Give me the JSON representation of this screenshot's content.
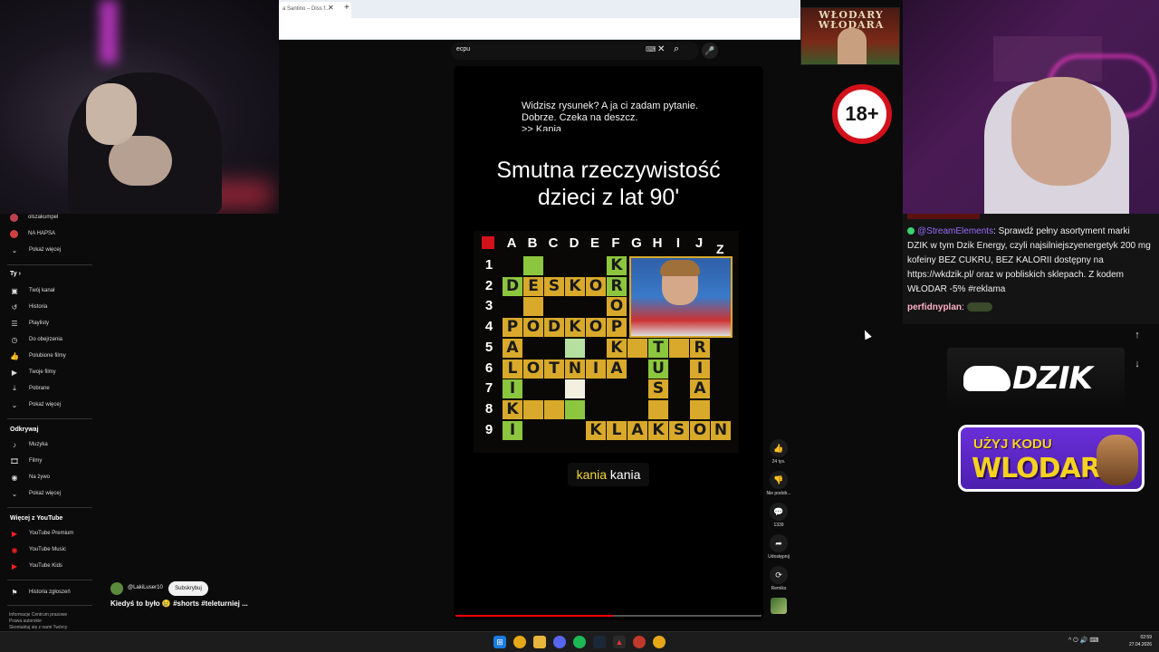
{
  "browser": {
    "tab_title": "a Santino – Diss f...",
    "new_tab": "+"
  },
  "search": {
    "query": "ecpu"
  },
  "banner": {
    "title": "WŁODARY WŁODARA"
  },
  "age_badge": "18+",
  "sidebar": {
    "subs": [
      {
        "label": "olszakumpel",
        "color": "#c04050"
      },
      {
        "label": "NA HAPSA",
        "color": "#d04040"
      },
      {
        "label": "Pokaż więcej",
        "icon": "chevron-down-icon"
      }
    ],
    "you_header": "Ty",
    "you_items": [
      {
        "label": "Twój kanał",
        "icon": "channel-icon"
      },
      {
        "label": "Historia",
        "icon": "history-icon"
      },
      {
        "label": "Playlisty",
        "icon": "playlist-icon"
      },
      {
        "label": "Do obejrzenia",
        "icon": "clock-icon"
      },
      {
        "label": "Polubione filmy",
        "icon": "like-icon"
      },
      {
        "label": "Twoje filmy",
        "icon": "video-icon"
      },
      {
        "label": "Pobrane",
        "icon": "download-icon"
      },
      {
        "label": "Pokaż więcej",
        "icon": "chevron-down-icon"
      }
    ],
    "explore_header": "Odkrywaj",
    "explore_items": [
      {
        "label": "Muzyka",
        "icon": "music-icon"
      },
      {
        "label": "Filmy",
        "icon": "film-icon"
      },
      {
        "label": "Na żywo",
        "icon": "live-icon"
      },
      {
        "label": "Pokaż więcej",
        "icon": "chevron-down-icon"
      }
    ],
    "more_header": "Więcej z YouTube",
    "more_items": [
      {
        "label": "YouTube Premium",
        "icon": "youtube-premium-icon"
      },
      {
        "label": "YouTube Music",
        "icon": "youtube-music-icon"
      },
      {
        "label": "YouTube Kids",
        "icon": "youtube-kids-icon"
      }
    ],
    "report_item": {
      "label": "Historia zgłoszeń",
      "icon": "flag-icon"
    },
    "footer": [
      "Informacje  Centrum prasowe",
      "Prawa autorskie",
      "Skontaktuj się z nami  Twórcy"
    ]
  },
  "short": {
    "dialog_lines": [
      "Widzisz rysunek? A ja ci zadam pytanie.",
      "Dobrze. Czeka na deszcz.",
      ">> Kania"
    ],
    "title_lines": [
      "Smutna rzeczywistość",
      "dzieci z lat 90'"
    ],
    "caption_highlight": "kania",
    "caption_rest": " kania",
    "progress": 0.515,
    "crossword": {
      "columns": [
        "A",
        "B",
        "C",
        "D",
        "E",
        "F",
        "G",
        "H",
        "I",
        "J"
      ],
      "rows": [
        "1",
        "2",
        "3",
        "4",
        "5",
        "6",
        "7",
        "8",
        "9"
      ],
      "col_extra": "Z"
    }
  },
  "actions": {
    "likes": "24 tys.",
    "dislike": "Nie podob...",
    "comments": "1339",
    "share": "Udostępnij",
    "remix": "Remiks"
  },
  "channel": {
    "name": "@LakiLuser10",
    "subscribe": "Subskrybuj"
  },
  "video_title": "Kiedyś to było 😢 #shorts #teleturniej ...",
  "chat": {
    "msg1_user": "@StreamElements",
    "msg1_text": ": Sprawdź pełny asortyment marki DZIK w tym Dzik Energy, czyli najsilniejszyenergetyk 200 mg kofeiny BEZ CUKRU, BEZ KALORII dostępny na https://wkdzik.pl/ oraz w pobliskich sklepach. Z kodem WŁODAR -5% #reklama",
    "msg2_user": "perfidnyplan",
    "msg2_text": ":"
  },
  "ads": {
    "dzik": "DZIK",
    "code_line1": "UŻYJ KODU",
    "code_line2": "WLODAR"
  },
  "taskbar": {
    "clock_time": "02:59",
    "clock_date": "27.04.2026",
    "tray": "^  ⏻  🔊  ⌨"
  }
}
